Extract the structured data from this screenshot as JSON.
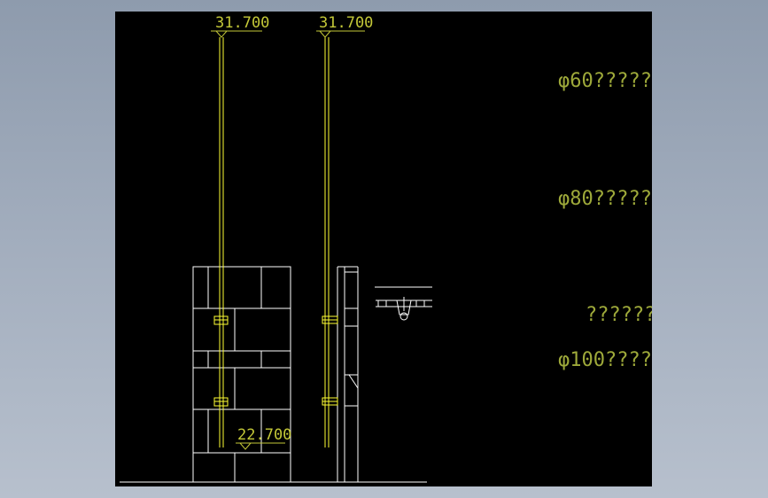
{
  "levels": {
    "top_left": "31.700",
    "top_right": "31.700",
    "bottom": "22.700"
  },
  "notes": {
    "n1": "φ60?????",
    "n2": "φ80?????",
    "n3": "??????",
    "n4": "φ100?????"
  },
  "colors": {
    "background": "#000000",
    "outline": "#ffffff",
    "pipe": "#ffff33",
    "text_level": "#c4c838",
    "text_note": "#9ea93a"
  }
}
